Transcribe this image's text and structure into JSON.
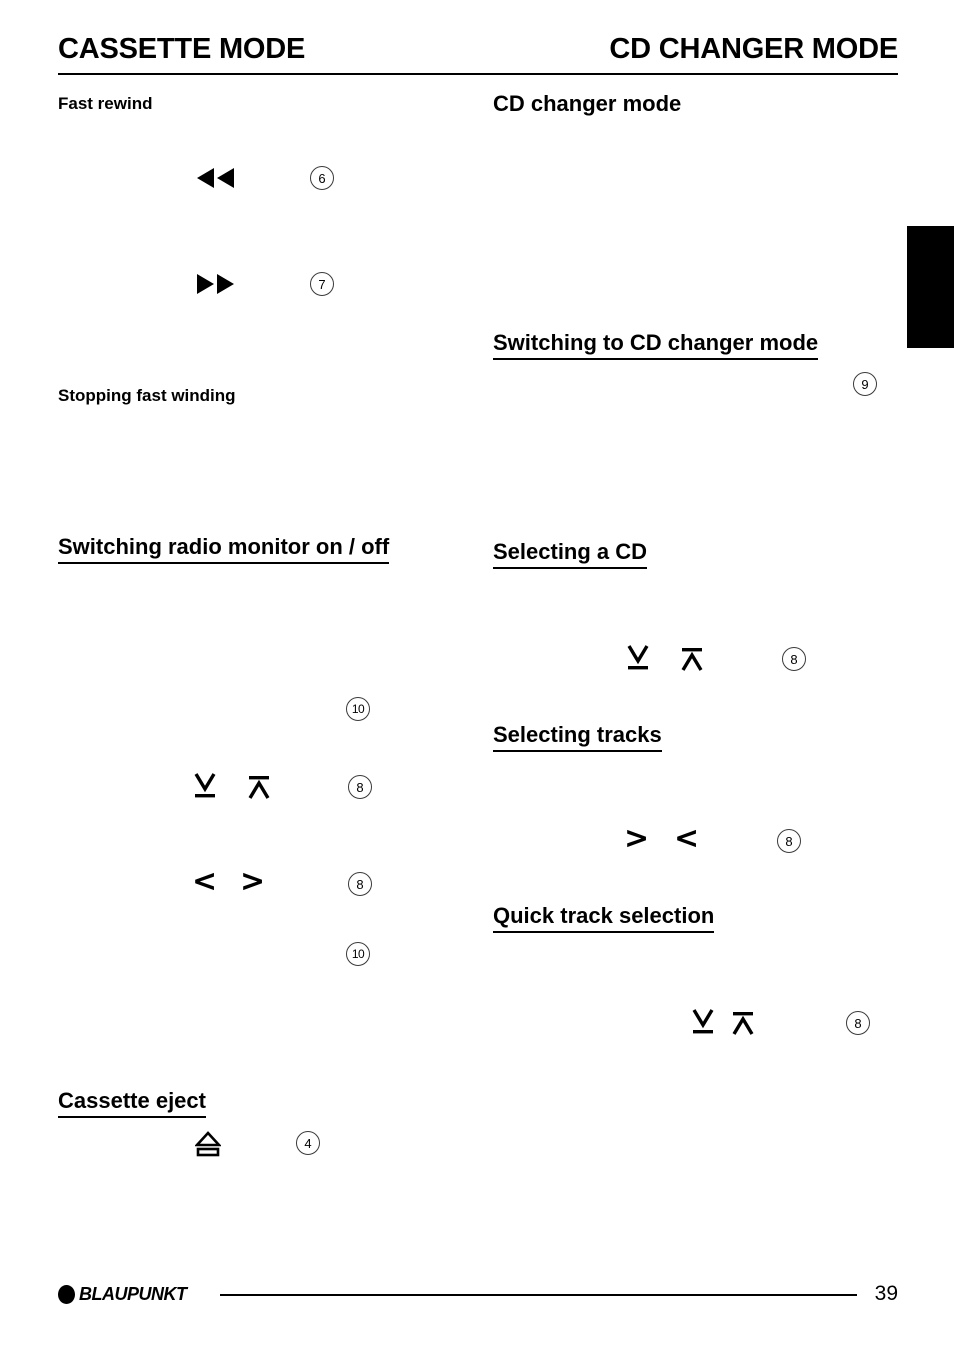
{
  "header": {
    "left_title": "CASSETTE MODE",
    "right_title": "CD CHANGER MODE"
  },
  "left_column": {
    "heading_fast_rewind": "Fast rewind",
    "heading_stopping": "Stopping fast winding",
    "heading_radio_monitor": "Switching radio monitor on / off",
    "heading_cassette_eject": "Cassette eject",
    "refs": {
      "rewind": "6",
      "forward": "7",
      "monitor_10_a": "10",
      "monitor_8_a": "8",
      "monitor_8_b": "8",
      "monitor_10_b": "10",
      "eject": "4"
    },
    "icons": {
      "rewind": "rewind-double-arrow-icon",
      "forward": "fast-forward-double-arrow-icon",
      "down_bar": "down-arrow-bar-icon",
      "up_bar": "up-arrow-bar-icon",
      "chevron_left": "chevron-left-icon",
      "chevron_right": "chevron-right-icon",
      "eject": "eject-icon"
    },
    "chevrons": {
      "first": "<",
      "second": ">"
    }
  },
  "right_column": {
    "heading_cd_changer_mode": "CD changer mode",
    "heading_switching": "Switching to CD changer mode",
    "heading_selecting_cd": "Selecting a CD",
    "heading_selecting_tracks": "Selecting tracks",
    "heading_quick_track": "Quick track selection",
    "refs": {
      "switching": "9",
      "selecting_cd": "8",
      "selecting_tracks": "8",
      "quick_track": "8"
    },
    "chevrons": {
      "first": ">",
      "second": "<"
    }
  },
  "edge_tab": {
    "name": "chapter-edge-tab",
    "color": "#000000"
  },
  "footer": {
    "brand": "BLAUPUNKT",
    "page_number": "39"
  }
}
